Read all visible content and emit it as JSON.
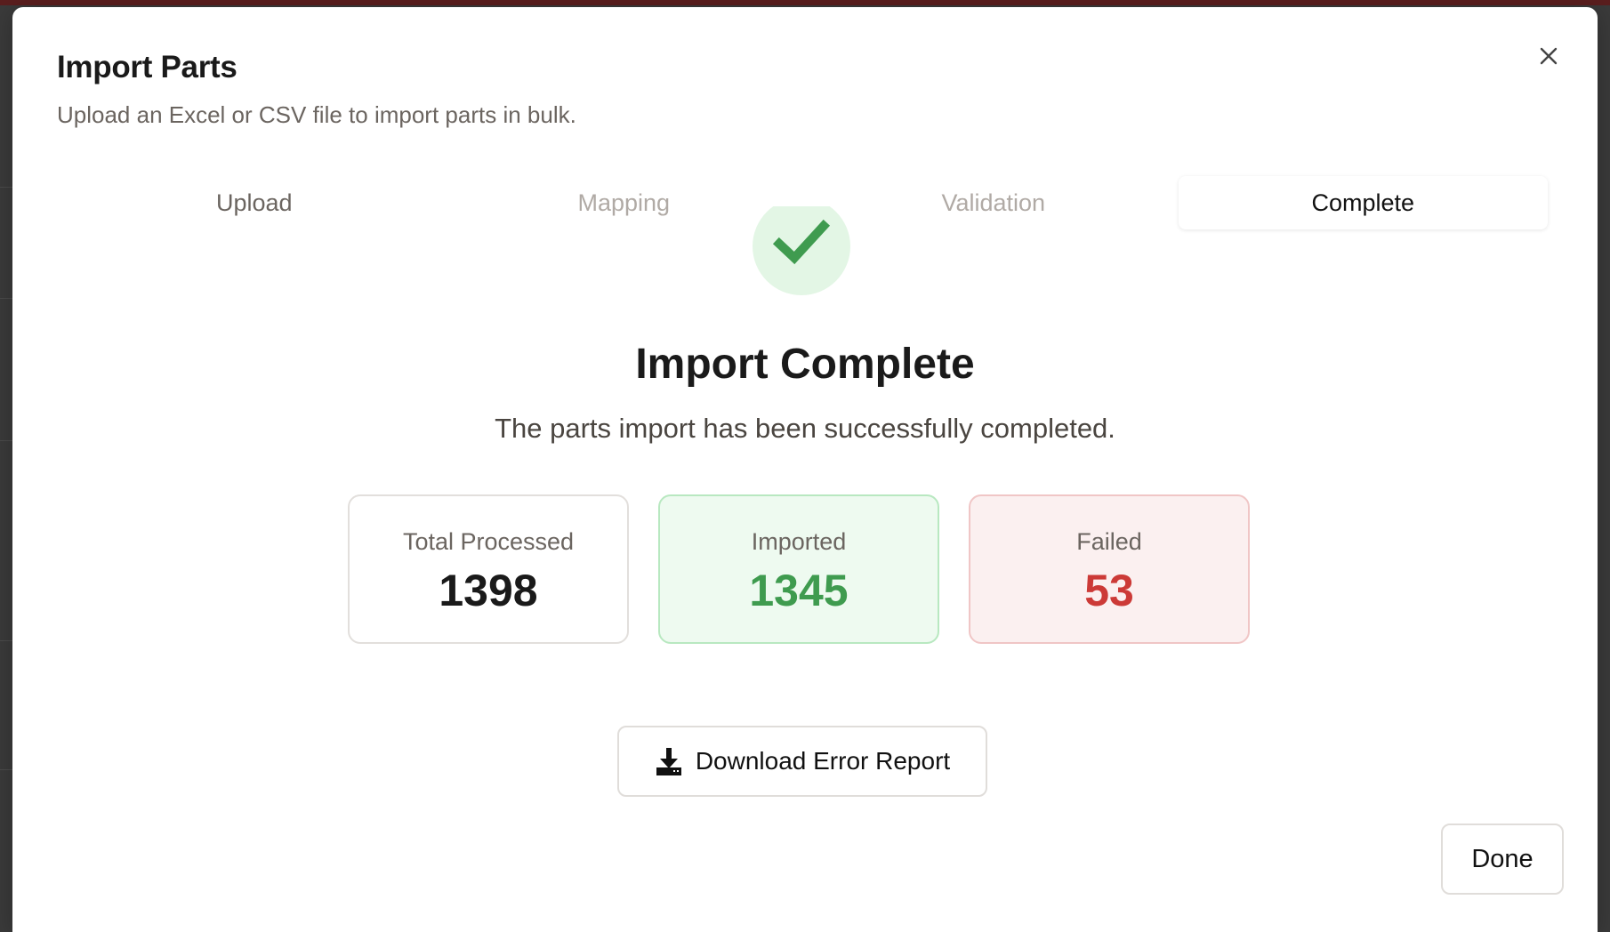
{
  "dialog": {
    "title": "Import Parts",
    "subtitle": "Upload an Excel or CSV file to import parts in bulk."
  },
  "steps": [
    {
      "label": "Upload",
      "state": "done"
    },
    {
      "label": "Mapping",
      "state": "pending"
    },
    {
      "label": "Validation",
      "state": "pending"
    },
    {
      "label": "Complete",
      "state": "active"
    }
  ],
  "result": {
    "heading": "Import Complete",
    "message": "The parts import has been successfully completed."
  },
  "stats": {
    "total": {
      "label": "Total Processed",
      "value": "1398"
    },
    "imported": {
      "label": "Imported",
      "value": "1345"
    },
    "failed": {
      "label": "Failed",
      "value": "53"
    }
  },
  "actions": {
    "download_label": "Download Error Report",
    "done_label": "Done"
  },
  "icons": {
    "close": "close-icon",
    "success": "checkmark-icon",
    "download": "download-icon"
  },
  "colors": {
    "success": "#3f9b4f",
    "success_bg": "#e3f6e5",
    "failed": "#cc3a37",
    "failed_bg": "#fbf0f0"
  }
}
